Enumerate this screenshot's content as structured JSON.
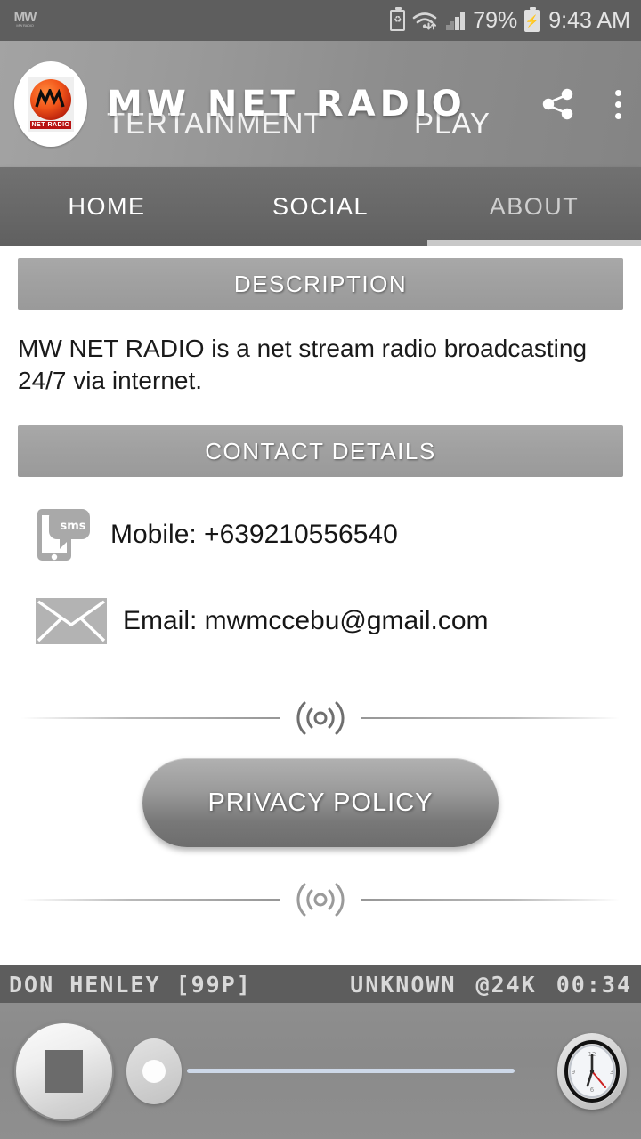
{
  "status_bar": {
    "app_icon_label": "MW",
    "app_icon_sub": "MW RADIO",
    "battery_saver_glyph": "♻",
    "battery_percent": "79%",
    "charging_glyph": "⚡",
    "time": "9:43 AM"
  },
  "app_bar": {
    "logo_mark": "⅄⅄",
    "logo_caption": "NET RADIO",
    "title": "MW NET RADIO",
    "background_text_left": "TERTAINMENT",
    "background_text_right": "PLAY",
    "share_label": "share-icon",
    "overflow_label": "more-options-icon"
  },
  "tabs": {
    "items": [
      {
        "label": "HOME",
        "active": false
      },
      {
        "label": "SOCIAL",
        "active": false
      },
      {
        "label": "ABOUT",
        "active": true
      }
    ],
    "active_index": 2
  },
  "about": {
    "description_heading": "DESCRIPTION",
    "description_text": "MW NET RADIO is a net stream radio broadcasting 24/7 via internet.",
    "contact_heading": "CONTACT DETAILS",
    "mobile": "Mobile: +639210556540",
    "email": "Email: mwmccebu@gmail.com",
    "privacy_button": "PRIVACY POLICY"
  },
  "player": {
    "track_title": "DON HENLEY [99P]",
    "genre": "UNKNOWN",
    "bitrate": "@24K",
    "elapsed": "00:34",
    "stop_label": "stop-button",
    "seek_value_percent": 0,
    "clock_label": "sleep-timer-clock"
  },
  "colors": {
    "status_bar_bg": "#5e5e5e",
    "app_bar_bg": "#9a9a9a",
    "tab_bar_bg": "#686868",
    "tab_indicator": "#c8c8c8",
    "section_head_bg": "#a2a2a2",
    "player_display_bg": "#5d5d5d",
    "player_controls_bg": "#8c8c8c",
    "seek_track": "#cdd8e8",
    "logo_red": "#b81414",
    "clock_second_hand": "#cc2222"
  }
}
